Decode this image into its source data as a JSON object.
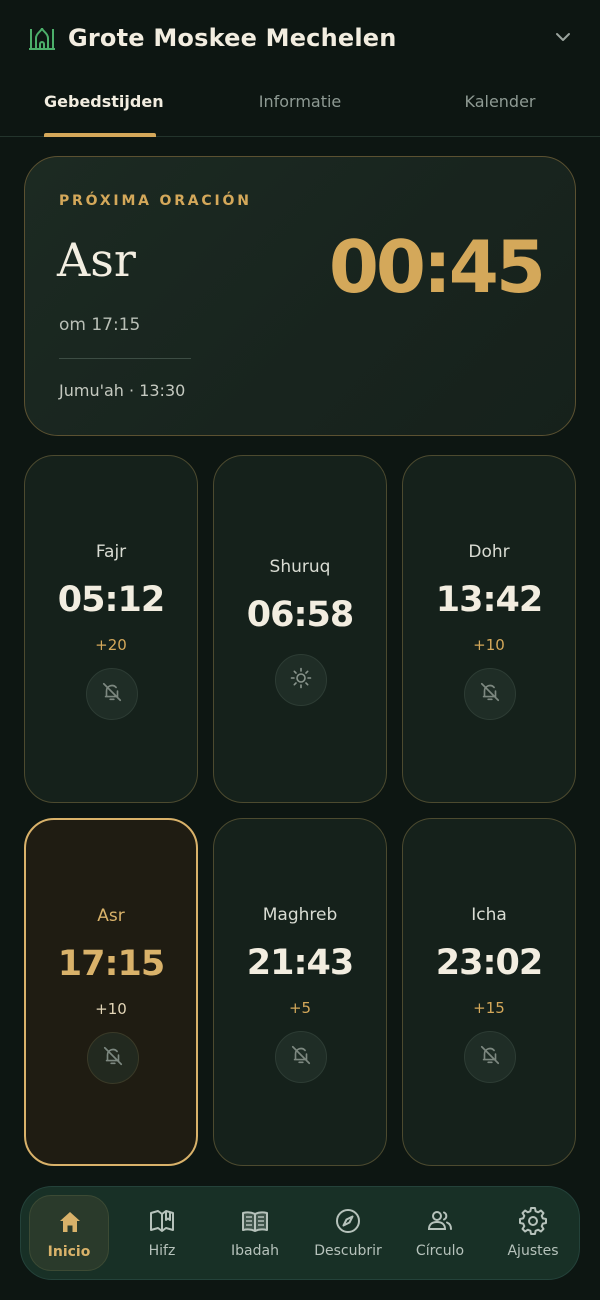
{
  "header": {
    "title": "Grote Moskee Mechelen",
    "icon": "mosque-icon"
  },
  "tabs": [
    {
      "label": "Gebedstijden",
      "active": true
    },
    {
      "label": "Informatie",
      "active": false
    },
    {
      "label": "Kalender",
      "active": false
    }
  ],
  "next_prayer": {
    "label": "PRÓXIMA ORACIÓN",
    "name": "Asr",
    "at": "om 17:15",
    "countdown": "00:45",
    "jumuah": "Jumu'ah · 13:30"
  },
  "prayers": [
    {
      "name": "Fajr",
      "time": "05:12",
      "offset": "+20",
      "icon": "bell-off-icon"
    },
    {
      "name": "Shuruq",
      "time": "06:58",
      "offset": "",
      "icon": "sun-icon"
    },
    {
      "name": "Dohr",
      "time": "13:42",
      "offset": "+10",
      "icon": "bell-off-icon"
    },
    {
      "name": "Asr",
      "time": "17:15",
      "offset": "+10",
      "icon": "bell-off-icon",
      "active": true
    },
    {
      "name": "Maghreb",
      "time": "21:43",
      "offset": "+5",
      "icon": "bell-off-icon"
    },
    {
      "name": "Icha",
      "time": "23:02",
      "offset": "+15",
      "icon": "bell-off-icon"
    }
  ],
  "nav": [
    {
      "label": "Inicio",
      "icon": "home-icon",
      "active": true
    },
    {
      "label": "Hifz",
      "icon": "open-book-icon"
    },
    {
      "label": "Ibadah",
      "icon": "book-icon"
    },
    {
      "label": "Descubrir",
      "icon": "compass-icon"
    },
    {
      "label": "Círculo",
      "icon": "people-icon"
    },
    {
      "label": "Ajustes",
      "icon": "gear-icon"
    }
  ],
  "colors": {
    "background": "#0d1612",
    "accent": "#d4a85a",
    "card": "#15211b",
    "nav": "#183026"
  }
}
